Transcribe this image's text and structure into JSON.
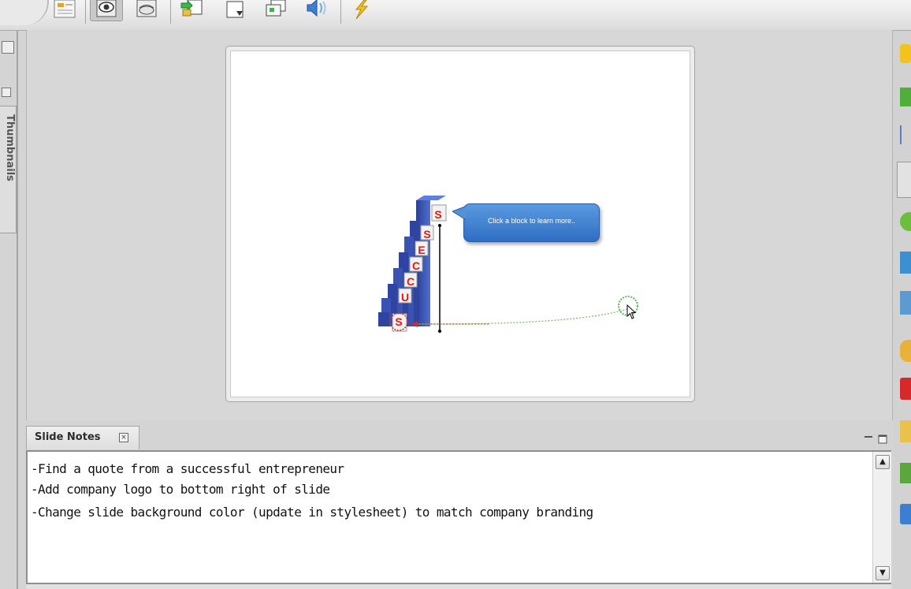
{
  "toolbar": {
    "buttons": [
      {
        "icon": "outline-view-icon",
        "pressed": false
      },
      {
        "icon": "preview-eye-icon",
        "pressed": true
      },
      {
        "icon": "stage-view-icon",
        "pressed": false
      },
      {
        "icon": "import-slide-icon",
        "pressed": false
      },
      {
        "icon": "new-slide-icon",
        "pressed": false
      },
      {
        "icon": "duplicate-slide-icon",
        "pressed": false
      },
      {
        "icon": "audio-icon",
        "pressed": false
      },
      {
        "icon": "publish-lightning-icon",
        "pressed": false
      }
    ]
  },
  "left_panel": {
    "tab_label": "Thumbnails"
  },
  "slide": {
    "stair_letters": [
      "S",
      "S",
      "E",
      "C",
      "C",
      "U",
      "S"
    ],
    "callout_text": "Click a block to learn more..",
    "accent_red": "#e8140f",
    "block_blue": "#3a54b4",
    "callout_blue": "#3e80d2"
  },
  "notes": {
    "tab_title": "Slide Notes",
    "lines": [
      "-Find a quote from a successful entrepreneur",
      "-Add company logo to bottom right of slide",
      "-Change slide background color (update in stylesheet) to match company branding"
    ]
  },
  "right_palette": {
    "tools": [
      "callout-icon",
      "rectangle-icon",
      "line-icon",
      "note-icon",
      "shape-icon",
      "image-icon",
      "picture-icon",
      "media-icon",
      "flash-icon",
      "tool-icon",
      "table-icon",
      "widget-icon"
    ]
  }
}
